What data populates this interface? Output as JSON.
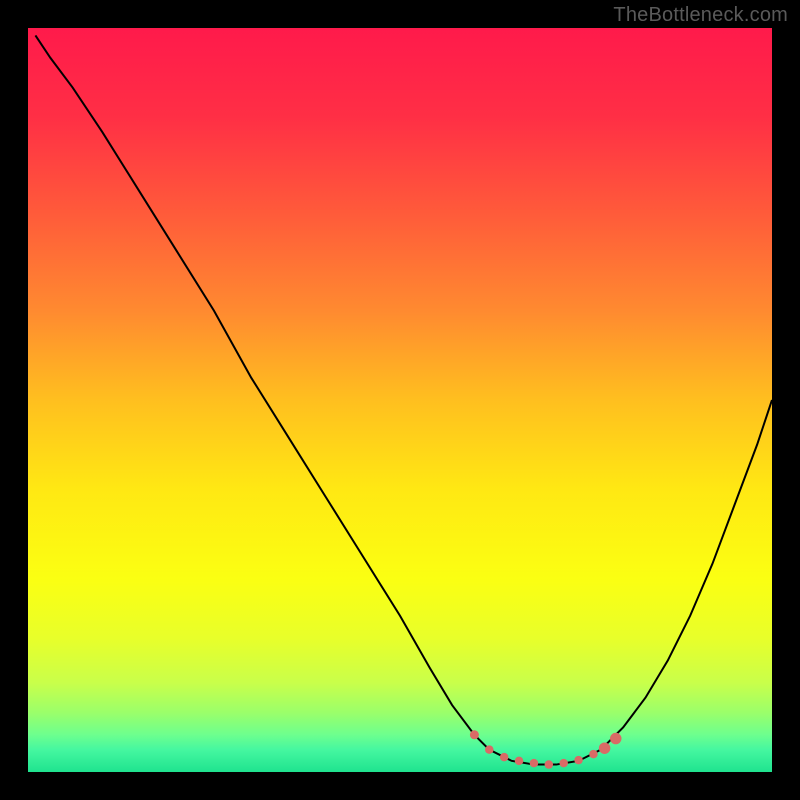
{
  "watermark": "TheBottleneck.com",
  "chart_data": {
    "type": "line",
    "title": "",
    "xlabel": "",
    "ylabel": "",
    "xlim": [
      0,
      100
    ],
    "ylim": [
      0,
      100
    ],
    "gradient_stops": [
      {
        "offset": 0,
        "color": "#ff1a4b"
      },
      {
        "offset": 12,
        "color": "#ff2f45"
      },
      {
        "offset": 25,
        "color": "#ff5b3a"
      },
      {
        "offset": 38,
        "color": "#ff8a30"
      },
      {
        "offset": 50,
        "color": "#ffbf1f"
      },
      {
        "offset": 62,
        "color": "#ffe813"
      },
      {
        "offset": 74,
        "color": "#fbff12"
      },
      {
        "offset": 82,
        "color": "#e8ff2a"
      },
      {
        "offset": 88,
        "color": "#c9ff4a"
      },
      {
        "offset": 92,
        "color": "#9bff6a"
      },
      {
        "offset": 95,
        "color": "#6dff8e"
      },
      {
        "offset": 97,
        "color": "#45f7a0"
      },
      {
        "offset": 100,
        "color": "#1fe38f"
      }
    ],
    "series": [
      {
        "name": "curve",
        "stroke": "#000000",
        "stroke_width": 2,
        "points": [
          {
            "x": 1,
            "y": 99
          },
          {
            "x": 3,
            "y": 96
          },
          {
            "x": 6,
            "y": 92
          },
          {
            "x": 10,
            "y": 86
          },
          {
            "x": 15,
            "y": 78
          },
          {
            "x": 20,
            "y": 70
          },
          {
            "x": 25,
            "y": 62
          },
          {
            "x": 30,
            "y": 53
          },
          {
            "x": 35,
            "y": 45
          },
          {
            "x": 40,
            "y": 37
          },
          {
            "x": 45,
            "y": 29
          },
          {
            "x": 50,
            "y": 21
          },
          {
            "x": 54,
            "y": 14
          },
          {
            "x": 57,
            "y": 9
          },
          {
            "x": 60,
            "y": 5
          },
          {
            "x": 62,
            "y": 3
          },
          {
            "x": 65,
            "y": 1.5
          },
          {
            "x": 68,
            "y": 1
          },
          {
            "x": 71,
            "y": 1
          },
          {
            "x": 74,
            "y": 1.5
          },
          {
            "x": 77,
            "y": 3
          },
          {
            "x": 80,
            "y": 6
          },
          {
            "x": 83,
            "y": 10
          },
          {
            "x": 86,
            "y": 15
          },
          {
            "x": 89,
            "y": 21
          },
          {
            "x": 92,
            "y": 28
          },
          {
            "x": 95,
            "y": 36
          },
          {
            "x": 98,
            "y": 44
          },
          {
            "x": 100,
            "y": 50
          }
        ]
      },
      {
        "name": "highlight-dots",
        "stroke": "#d96a66",
        "fill": "#d96a66",
        "radius": 5,
        "points": [
          {
            "x": 60,
            "y": 5
          },
          {
            "x": 62,
            "y": 3
          },
          {
            "x": 64,
            "y": 2
          },
          {
            "x": 66,
            "y": 1.5
          },
          {
            "x": 68,
            "y": 1.2
          },
          {
            "x": 70,
            "y": 1
          },
          {
            "x": 72,
            "y": 1.2
          },
          {
            "x": 74,
            "y": 1.6
          },
          {
            "x": 76,
            "y": 2.4
          },
          {
            "x": 77.5,
            "y": 3.2
          },
          {
            "x": 79,
            "y": 4.5
          }
        ]
      }
    ]
  }
}
